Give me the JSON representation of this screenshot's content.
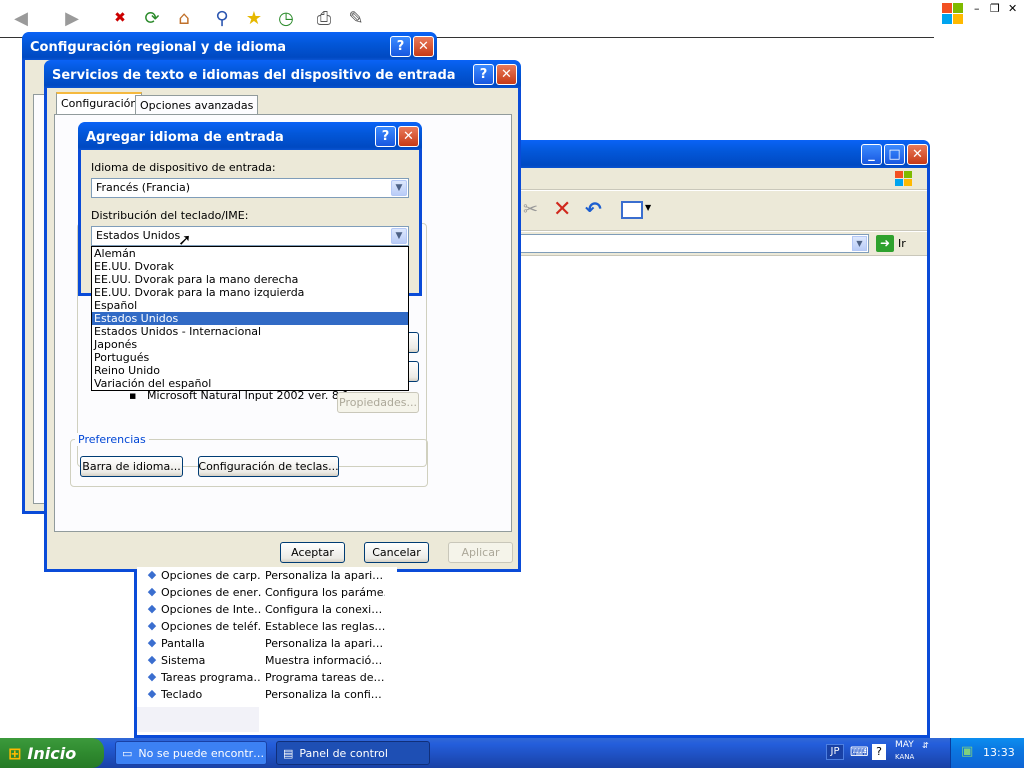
{
  "ie_toolbar": {
    "icons": [
      "back-icon",
      "forward-icon",
      "stop-icon",
      "refresh-icon",
      "home-icon",
      "search-icon",
      "favorites-icon",
      "history-icon",
      "print-icon",
      "edit-icon"
    ]
  },
  "control_panel": {
    "address_go": "Ir",
    "items": [
      {
        "name": "Opciones de carp…",
        "desc": "Personaliza la apari…",
        "icon": "folder-options-icon"
      },
      {
        "name": "Opciones de ener…",
        "desc": "Configura los paráme…",
        "icon": "power-options-icon"
      },
      {
        "name": "Opciones de Inte…",
        "desc": "Configura la conexi…",
        "icon": "internet-options-icon"
      },
      {
        "name": "Opciones de teléf…",
        "desc": "Establece las reglas…",
        "icon": "phone-options-icon"
      },
      {
        "name": "Pantalla",
        "desc": "Personaliza la apari…",
        "icon": "display-icon"
      },
      {
        "name": "Sistema",
        "desc": "Muestra informació…",
        "icon": "system-icon"
      },
      {
        "name": "Tareas programa…",
        "desc": "Programa tareas de…",
        "icon": "scheduled-tasks-icon"
      },
      {
        "name": "Teclado",
        "desc": "Personaliza la confi…",
        "icon": "keyboard-icon"
      }
    ]
  },
  "regional_window": {
    "title": "Configuración regional y de idioma"
  },
  "text_services": {
    "title": "Servicios de texto e idiomas del dispositivo de entrada",
    "tabs": [
      "Configuración",
      "Opciones avanzadas"
    ],
    "installed_item": "Microsoft Natural Input 2002 ver. 8.1",
    "properties_button": "Propiedades...",
    "preferences_label": "Preferencias",
    "language_bar_button": "Barra de idioma...",
    "key_settings_button": "Configuración de teclas...",
    "ok": "Aceptar",
    "cancel": "Cancelar",
    "apply": "Aplicar"
  },
  "add_language": {
    "title": "Agregar idioma de entrada",
    "input_language_label": "Idioma de dispositivo de entrada:",
    "input_language_value": "Francés (Francia)",
    "layout_label": "Distribución del teclado/IME:",
    "layout_value": "Estados Unidos",
    "options": [
      "Alemán",
      "EE.UU. Dvorak",
      "EE.UU. Dvorak para la mano derecha",
      "EE.UU. Dvorak para la mano izquierda",
      "Español",
      "Estados Unidos",
      "Estados Unidos - Internacional",
      "Japonés",
      "Portugués",
      "Reino Unido",
      "Variación del español"
    ],
    "selected_index": 5
  },
  "taskbar": {
    "start": "Inicio",
    "tasks": [
      "No se puede encontr…",
      "Panel de control"
    ],
    "lang": "JP",
    "ime_top": "MAY",
    "ime_bottom": "KANA",
    "clock": "13:33"
  }
}
